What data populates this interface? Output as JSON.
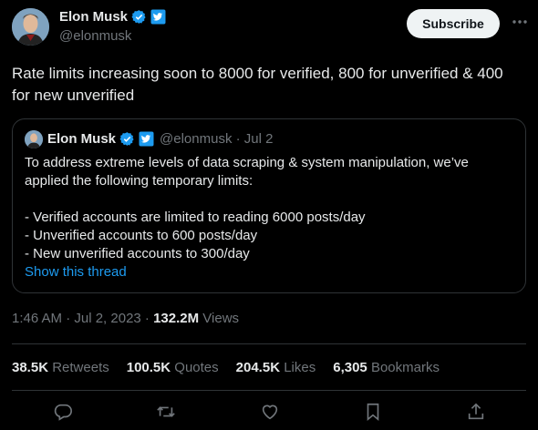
{
  "author": {
    "name": "Elon Musk",
    "handle": "@elonmusk"
  },
  "subscribe_label": "Subscribe",
  "tweet_text": "Rate limits increasing soon to 8000 for verified, 800 for unverified & 400 for new unverified",
  "quote": {
    "name": "Elon Musk",
    "handle_date": "@elonmusk · Jul 2",
    "line1": "To address extreme levels of data scraping & system manipulation, we’ve applied the following temporary limits:",
    "line2": "- Verified accounts are limited to reading 6000 posts/day",
    "line3": "- Unverified accounts to 600 posts/day",
    "line4": "- New unverified accounts to 300/day",
    "show_thread": "Show this thread"
  },
  "meta": {
    "timestamp": "1:46 AM · Jul 2, 2023 · ",
    "views_count": "132.2M",
    "views_label": " Views"
  },
  "stats": {
    "retweets_count": "38.5K",
    "retweets_label": "Retweets",
    "quotes_count": "100.5K",
    "quotes_label": "Quotes",
    "likes_count": "204.5K",
    "likes_label": "Likes",
    "bookmarks_count": "6,305",
    "bookmarks_label": "Bookmarks"
  },
  "icons": {
    "reply": "reply-icon",
    "retweet": "retweet-icon",
    "like": "heart-icon",
    "bookmark": "bookmark-icon",
    "share": "share-icon"
  },
  "colors": {
    "background": "#000000",
    "text": "#e7e9ea",
    "secondary_text": "#71767b",
    "link": "#1d9bf0",
    "border": "#2f3336"
  }
}
